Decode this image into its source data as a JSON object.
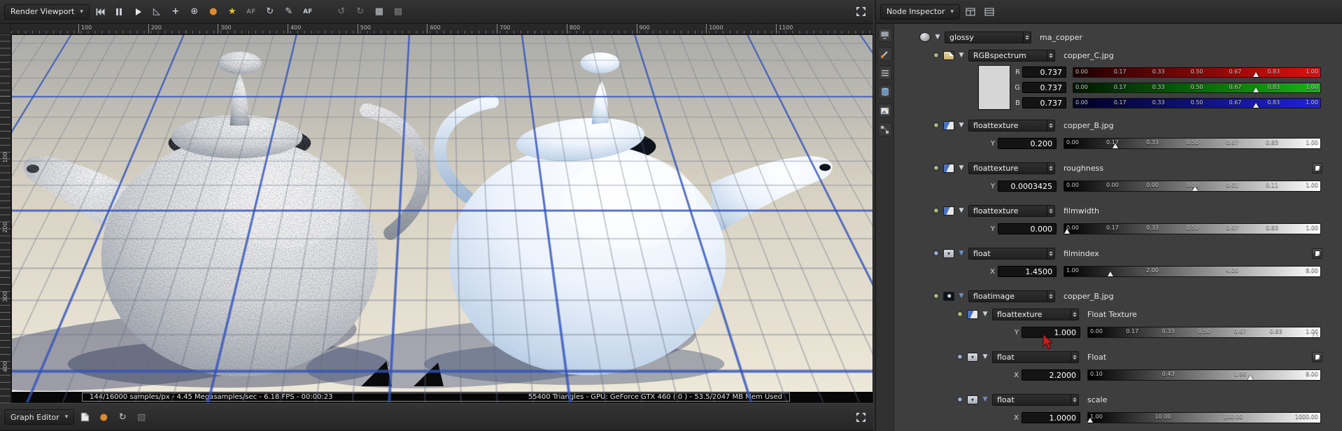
{
  "render_viewport": {
    "toolbar": {
      "title": "Render Viewport",
      "icons": [
        "skip-to-start-icon",
        "pause-icon",
        "play-icon",
        "flag-icon",
        "crosshair-icon",
        "target-icon",
        "paint-icon",
        "spark-icon",
        "af-dim-icon",
        "rotate-icon",
        "pen-icon",
        "af-icon",
        "undo-icon",
        "redo-icon",
        "grid-icon",
        "checker-icon",
        "fullscreen-icon"
      ],
      "af_dim_label": "AF",
      "af_label": "AF"
    },
    "ruler_top": [
      "100",
      "200",
      "300",
      "400",
      "500",
      "600",
      "700",
      "800",
      "900",
      "1000",
      "1100"
    ],
    "ruler_left": [
      "100",
      "200",
      "300",
      "400"
    ],
    "status_left": "144/16000 samples/px - 4.45 Megasamples/sec - 6.18 FPS - 00:00:23",
    "status_right": "55400 Triangles - GPU: GeForce GTX 460 ( 0 ) - 53.5/2047 MB Mem Used"
  },
  "graph_editor": {
    "title": "Graph Editor",
    "icons": [
      "new-file-icon",
      "paint-icon",
      "refresh-icon",
      "eraser-icon",
      "fullscreen-icon"
    ]
  },
  "node_inspector": {
    "title": "Node Inspector",
    "toolbar_icons": [
      "table-add-icon",
      "table-icon"
    ],
    "side_tabs": [
      "monitor-icon",
      "brush-icon",
      "list-icon",
      "storage-icon",
      "photo-icon",
      "nodes-icon"
    ],
    "swatch_color": "#d6d6d6",
    "rows": [
      {
        "kind": "header",
        "type": "glossy",
        "label": "ma_copper"
      },
      {
        "kind": "header",
        "type": "RGBspectrum",
        "label": "copper_C.jpg"
      },
      {
        "kind": "color",
        "channels": [
          {
            "ch": "R",
            "value": "0.737",
            "ticks": [
              "0.00",
              "0.17",
              "0.33",
              "0.50",
              "0.67",
              "0.83",
              "1.00"
            ],
            "marker_pct": 74
          },
          {
            "ch": "G",
            "value": "0.737",
            "ticks": [
              "0.00",
              "0.17",
              "0.33",
              "0.50",
              "0.67",
              "0.83",
              "1.00"
            ],
            "marker_pct": 74
          },
          {
            "ch": "B",
            "value": "0.737",
            "ticks": [
              "0.00",
              "0.17",
              "0.33",
              "0.50",
              "0.67",
              "0.83",
              "1.00"
            ],
            "marker_pct": 74
          }
        ]
      },
      {
        "kind": "header",
        "type": "floattexture",
        "label": "copper_B.jpg"
      },
      {
        "kind": "slider",
        "ch": "Y",
        "value": "0.200",
        "ticks": [
          "0.00",
          "0.17",
          "0.33",
          "0.50",
          "0.67",
          "0.83",
          "1.00"
        ],
        "marker_pct": 20
      },
      {
        "kind": "header",
        "type": "floattexture",
        "label": "roughness"
      },
      {
        "kind": "slider",
        "ch": "Y",
        "value": "0.0003425",
        "ticks": [
          "0.00",
          "0.00",
          "0.00",
          "0.00",
          "0.01",
          "0.11",
          "1.00"
        ],
        "marker_pct": 51
      },
      {
        "kind": "header",
        "type": "floattexture",
        "label": "filmwidth"
      },
      {
        "kind": "slider",
        "ch": "Y",
        "value": "0.000",
        "ticks": [
          "0.00",
          "0.17",
          "0.33",
          "0.50",
          "0.67",
          "0.83",
          "1.00"
        ],
        "marker_pct": 1
      },
      {
        "kind": "header",
        "type": "float",
        "label": "filmindex"
      },
      {
        "kind": "slider",
        "ch": "X",
        "value": "1.4500",
        "ticks": [
          "1.00",
          "2.00",
          "4.00",
          "8.00"
        ],
        "marker_pct": 18
      },
      {
        "kind": "header",
        "type": "floatimage",
        "label": "copper_B.jpg"
      },
      {
        "kind": "header",
        "type": "floattexture",
        "label": "Float Texture"
      },
      {
        "kind": "slider",
        "ch": "Y",
        "value": "1.000",
        "ticks": [
          "0.00",
          "0.17",
          "0.33",
          "0.50",
          "0.67",
          "0.83",
          "1.00"
        ],
        "marker_pct": 98
      },
      {
        "kind": "header",
        "type": "float",
        "label": "Float"
      },
      {
        "kind": "slider",
        "ch": "X",
        "value": "2.2000",
        "ticks": [
          "0.10",
          "0.43",
          "1.86",
          "8.00"
        ],
        "marker_pct": 70
      },
      {
        "kind": "header",
        "type": "float",
        "label": "scale"
      },
      {
        "kind": "slider",
        "ch": "X",
        "value": "1.0000",
        "ticks": [
          "1.00",
          "10.00",
          "100.00",
          "1000.00"
        ],
        "marker_pct": 1
      }
    ]
  }
}
